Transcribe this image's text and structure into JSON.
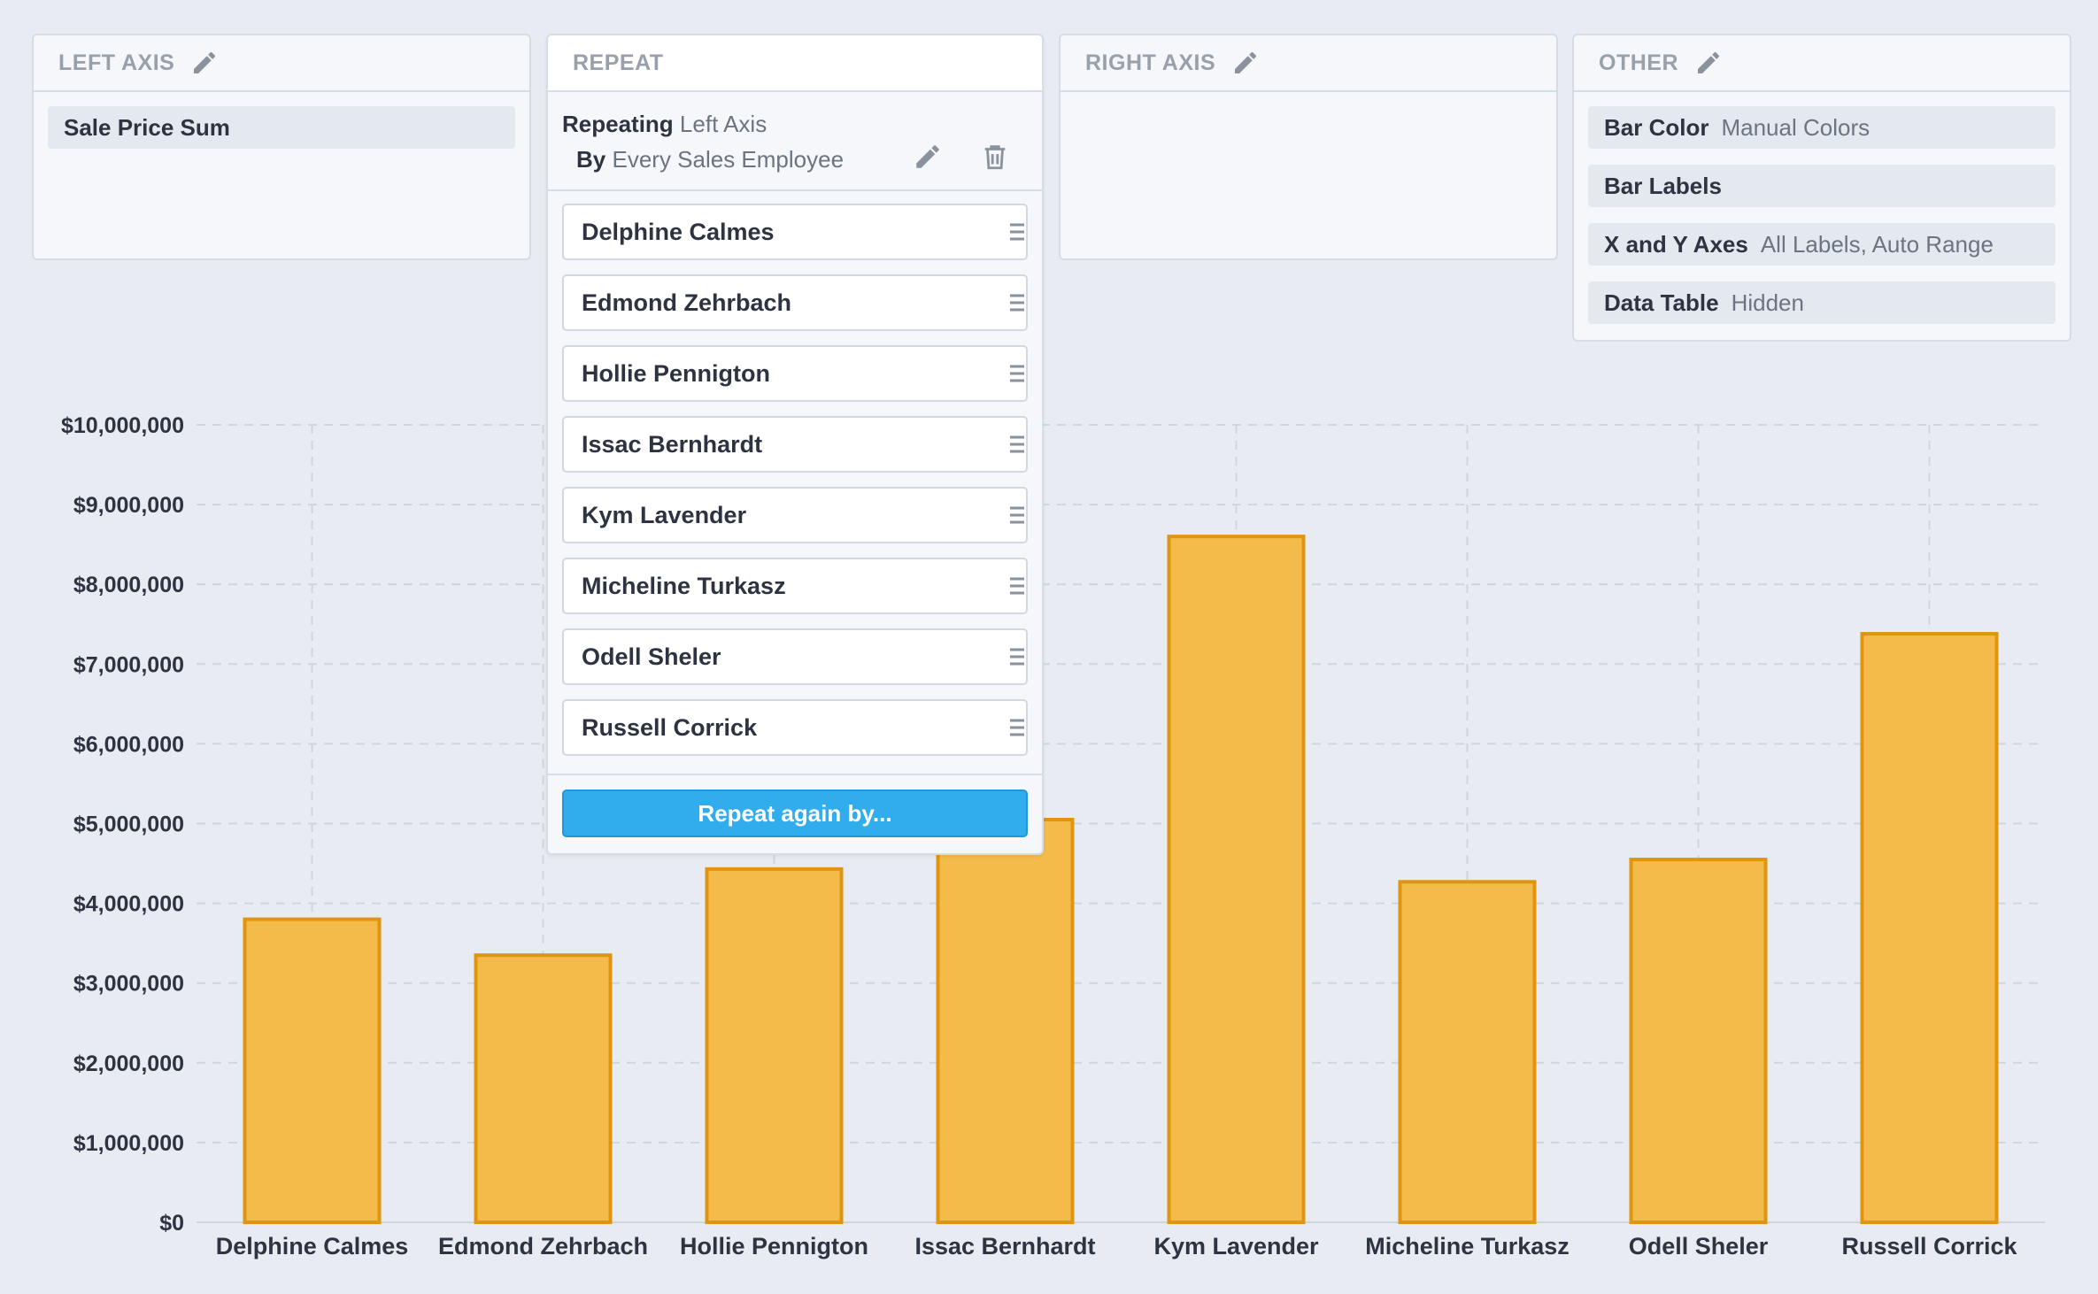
{
  "panels": {
    "left_axis": {
      "title": "LEFT AXIS",
      "items": [
        {
          "label": "Sale Price Sum"
        }
      ]
    },
    "repeat": {
      "title": "REPEAT",
      "repeating_key": "Repeating",
      "repeating_value": "Left Axis",
      "by_key": "By",
      "by_value": "Every Sales Employee",
      "employees": [
        "Delphine Calmes",
        "Edmond Zehrbach",
        "Hollie Pennigton",
        "Issac Bernhardt",
        "Kym Lavender",
        "Micheline Turkasz",
        "Odell Sheler",
        "Russell Corrick"
      ],
      "repeat_again_label": "Repeat again by..."
    },
    "right_axis": {
      "title": "RIGHT AXIS"
    },
    "other": {
      "title": "OTHER",
      "items": [
        {
          "key": "Bar Color",
          "value": "Manual Colors"
        },
        {
          "key": "Bar Labels",
          "value": ""
        },
        {
          "key": "X and Y Axes",
          "value": "All Labels, Auto Range"
        },
        {
          "key": "Data Table",
          "value": "Hidden"
        }
      ]
    }
  },
  "icons": {
    "edit": "pencil-icon",
    "delete": "trash-icon",
    "drag": "drag-handle-icon"
  },
  "colors": {
    "bar_fill": "#f4bb4a",
    "bar_stroke": "#e0950f",
    "button_blue": "#31acec"
  },
  "chart_data": {
    "type": "bar",
    "categories": [
      "Delphine Calmes",
      "Edmond Zehrbach",
      "Hollie Pennigton",
      "Issac Bernhardt",
      "Kym Lavender",
      "Micheline Turkasz",
      "Odell Sheler",
      "Russell Corrick"
    ],
    "values": [
      3800000,
      3350000,
      4430000,
      5050000,
      8600000,
      4270000,
      4550000,
      7380000
    ],
    "ylim": [
      0,
      10000000
    ],
    "yticks": [
      "$0",
      "$1,000,000",
      "$2,000,000",
      "$3,000,000",
      "$4,000,000",
      "$5,000,000",
      "$6,000,000",
      "$7,000,000",
      "$8,000,000",
      "$9,000,000",
      "$10,000,000"
    ],
    "grid": true,
    "title": "",
    "xlabel": "",
    "ylabel": ""
  }
}
